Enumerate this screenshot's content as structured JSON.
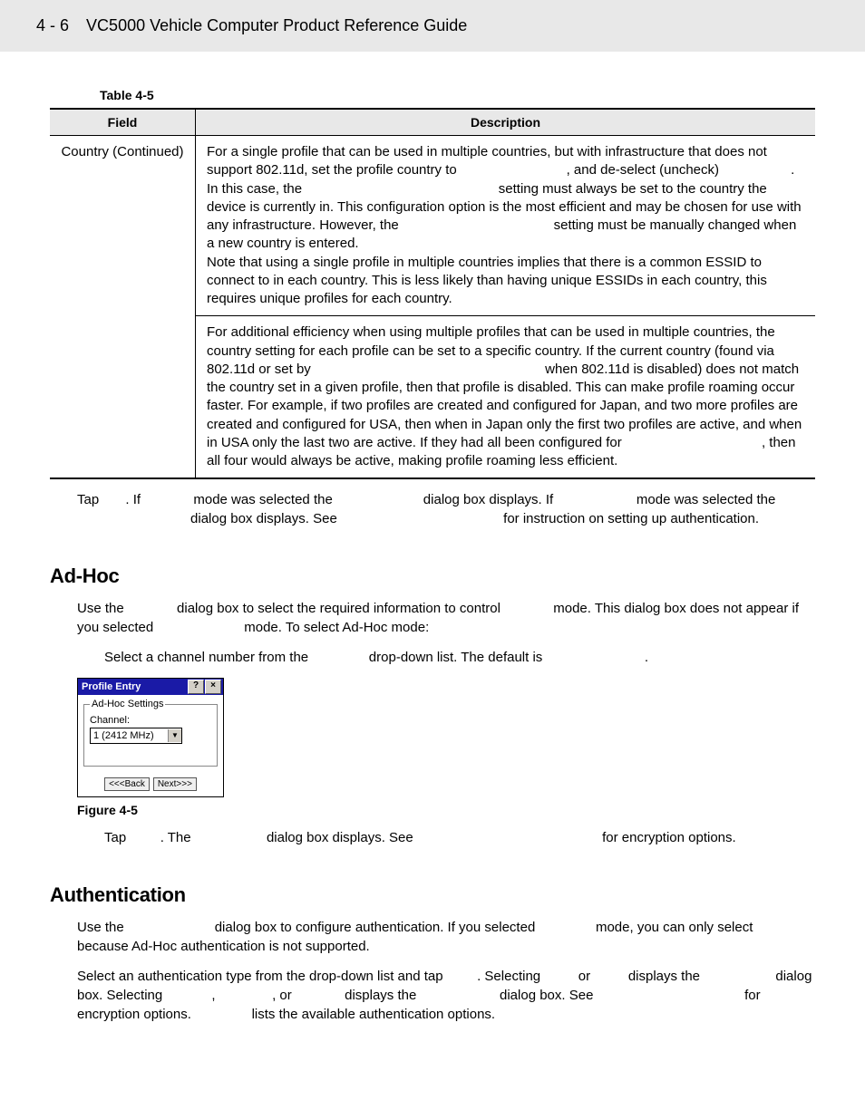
{
  "header": {
    "page_number": "4 - 6",
    "guide_title": "VC5000 Vehicle Computer Product Reference Guide"
  },
  "table": {
    "caption": "Table 4-5",
    "headers": {
      "field": "Field",
      "description": "Description"
    },
    "row1_field": "Country (Continued)",
    "row1_desc": "For a single profile that can be used in multiple countries, but with infrastructure that does not support 802.11d, set the profile country to                             , and de-select (uncheck)                   . In this case, the                                                    setting must always be set to the country the device is currently in. This configuration option is the most efficient and may be chosen for use with any infrastructure. However, the                                         setting must be manually changed when a new country is entered.\nNote that using a single profile in multiple countries implies that there is a common ESSID to connect to in each country. This is less likely than having unique ESSIDs in each country, this requires unique profiles for each country.",
    "row2_desc": "For additional efficiency when using multiple profiles that can be used in multiple countries, the country setting for each profile can be set to a specific country. If the current country (found via 802.11d or set by                                                              when 802.11d is disabled) does not match the country set in a given profile, then that profile is disabled. This can make profile roaming occur faster. For example, if two profiles are created and configured for Japan, and two more profiles are created and configured for USA, then when in Japan only the first two profiles are active, and when in USA only the last two are active. If they had all been configured for                                     , then all four would always be active, making profile roaming less efficient."
  },
  "para1": "Tap       . If              mode was selected the                        dialog box displays. If                      mode was selected the                               dialog box displays. See                                            for instruction on setting up authentication.",
  "adhoc": {
    "heading": "Ad-Hoc",
    "p1": "Use the              dialog box to select the required information to control              mode. This dialog box does not appear if you selected                        mode. To select Ad-Hoc mode:",
    "step": "Select a channel number from the                drop-down list. The default is                           .",
    "dialog": {
      "title": "Profile Entry",
      "help": "?",
      "close": "×",
      "legend": "Ad-Hoc Settings",
      "channel_label": "Channel:",
      "channel_value": "1 (2412 MHz)",
      "back": "<<<Back",
      "next": "Next>>>"
    },
    "fig": "Figure 4-5",
    "p2": "Tap         . The                    dialog box displays. See                                                  for encryption options."
  },
  "auth": {
    "heading": "Authentication",
    "p1": "Use the                        dialog box to configure authentication. If you selected                mode, you can only select          because Ad-Hoc authentication is not supported.",
    "p2": "Select an authentication type from the drop-down list and tap         . Selecting          or          displays the                    dialog box. Selecting             ,               , or              displays the                      dialog box. See                                        for encryption options.                lists the available authentication options."
  }
}
